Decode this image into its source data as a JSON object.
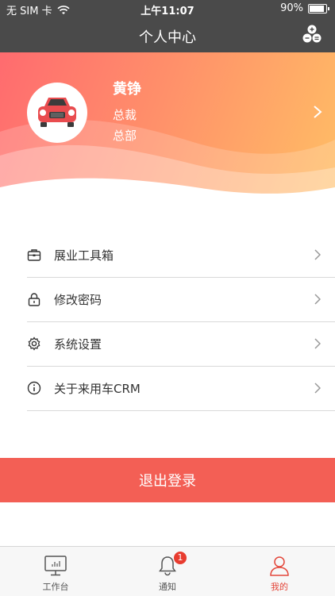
{
  "status_bar": {
    "carrier": "无 SIM 卡",
    "time": "上午11:07",
    "battery": "90%",
    "battery_level": 0.9
  },
  "nav": {
    "title": "个人中心",
    "right_icon": "blocks-icon"
  },
  "profile": {
    "name": "黄铮",
    "role": "总裁",
    "department": "总部",
    "avatar_icon": "car-icon"
  },
  "menu": {
    "items": [
      {
        "label": "展业工具箱",
        "icon": "toolbox-icon"
      },
      {
        "label": "修改密码",
        "icon": "lock-icon"
      },
      {
        "label": "系统设置",
        "icon": "gear-icon"
      },
      {
        "label": "关于来用车CRM",
        "icon": "info-icon"
      }
    ]
  },
  "logout_label": "退出登录",
  "tabbar": {
    "tabs": [
      {
        "label": "工作台",
        "icon": "monitor-icon"
      },
      {
        "label": "通知",
        "icon": "bell-icon",
        "badge": "1"
      },
      {
        "label": "我的",
        "icon": "user-icon"
      }
    ],
    "active_index": 2
  },
  "colors": {
    "accent": "#f35f55",
    "gradient_start": "#ff6b6f",
    "gradient_end": "#ffbe65",
    "active_tab": "#e3463a"
  }
}
